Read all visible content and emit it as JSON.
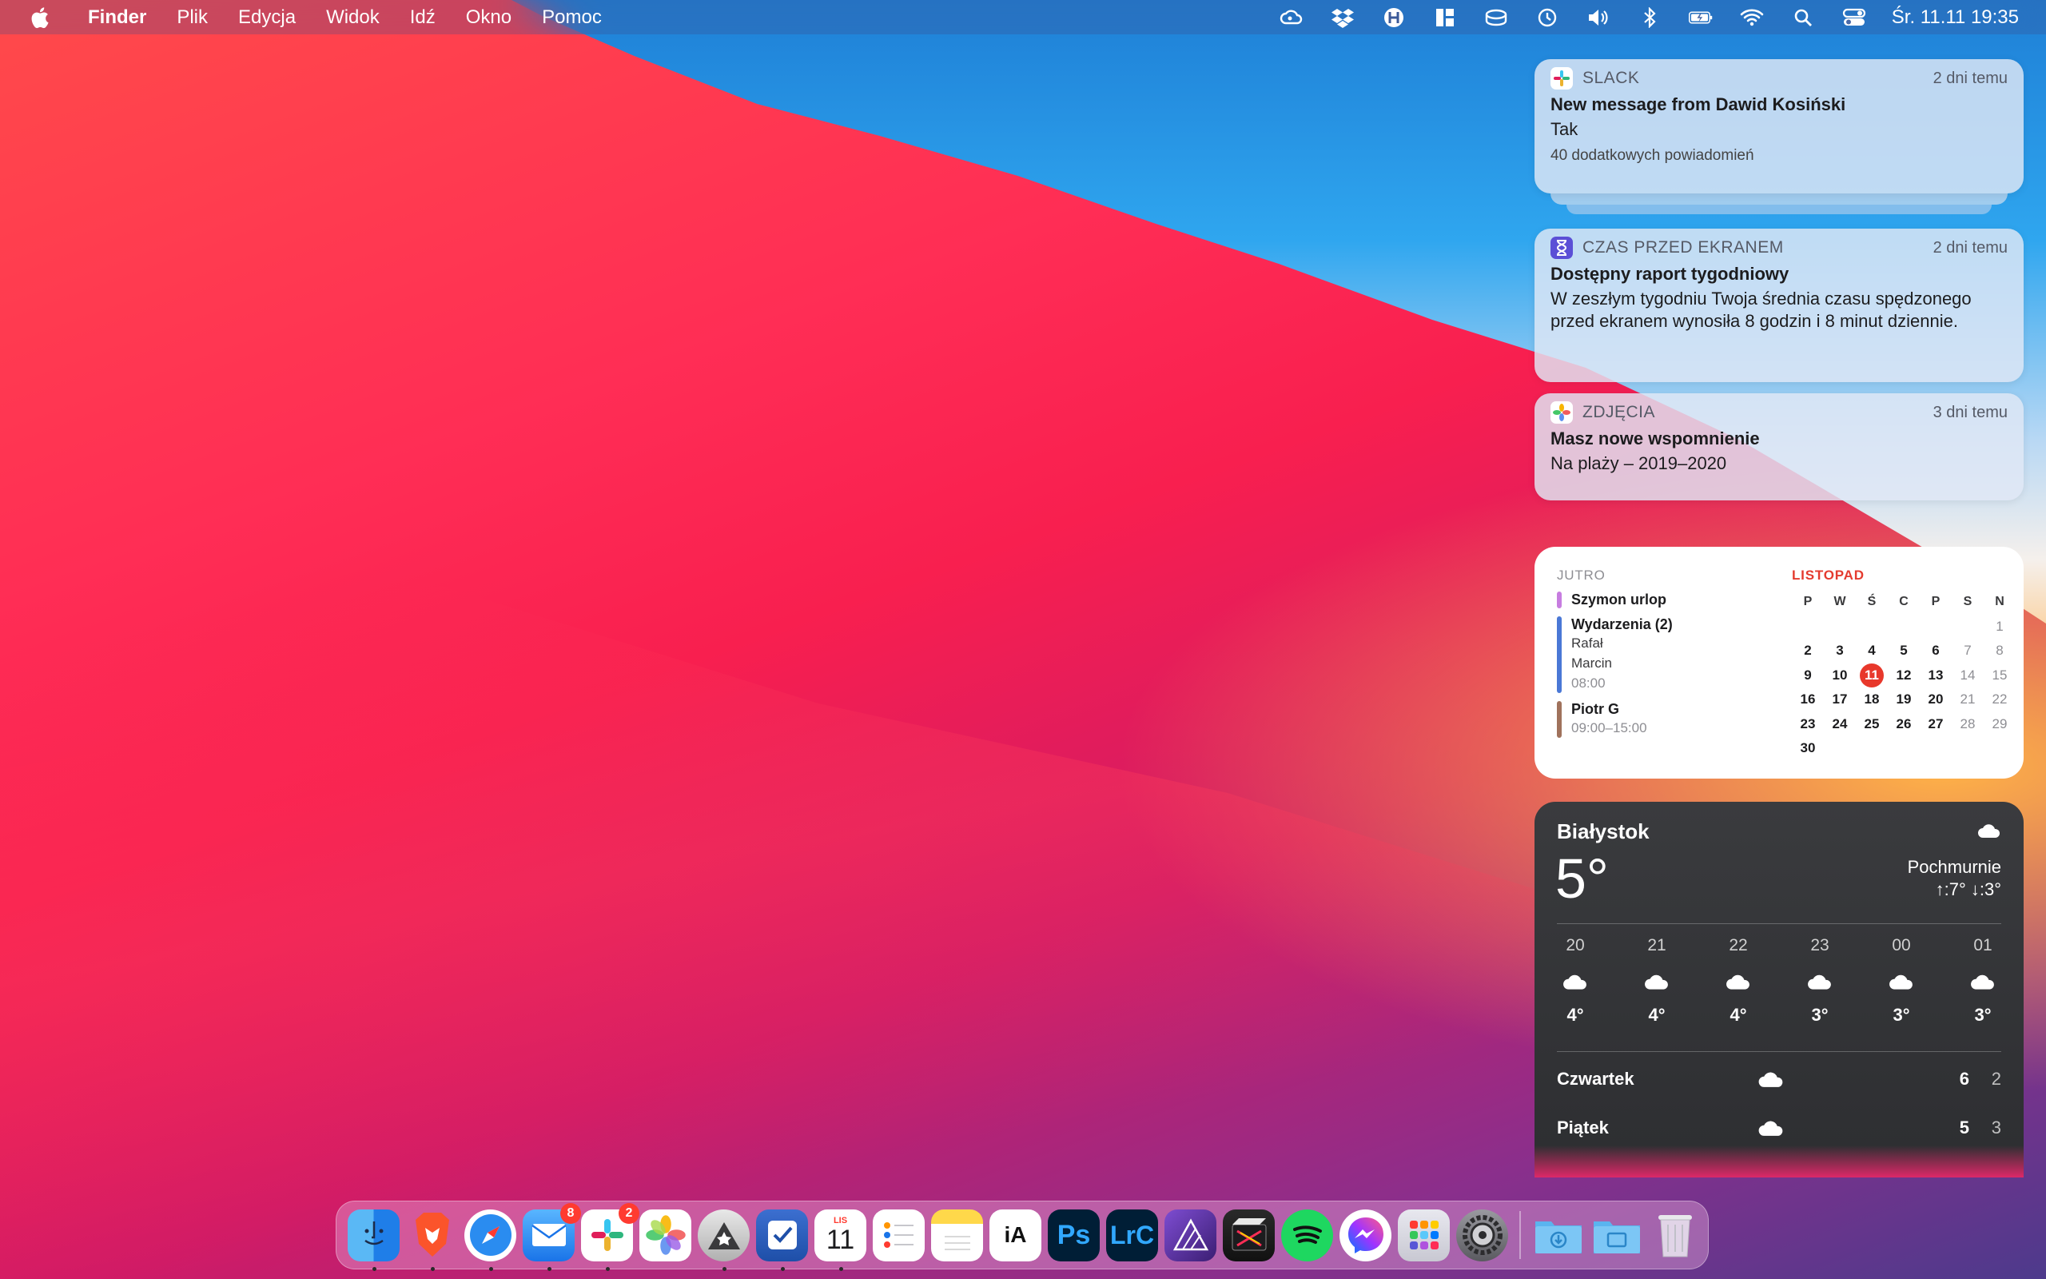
{
  "menubar": {
    "app": "Finder",
    "items": [
      "Plik",
      "Edycja",
      "Widok",
      "Idź",
      "Okno",
      "Pomoc"
    ],
    "clock": "Śr. 11.11  19:35",
    "status_icons": [
      "creative-cloud-icon",
      "dropbox-icon",
      "h-icon",
      "layout-icon",
      "bartender-icon",
      "time-machine-icon",
      "volume-icon",
      "bluetooth-icon",
      "battery-icon",
      "wifi-icon",
      "spotlight-icon",
      "control-center-icon"
    ]
  },
  "notifications": [
    {
      "app": "SLACK",
      "time": "2 dni temu",
      "title": "New message from Dawid Kosiński",
      "body": "Tak",
      "more": "40 dodatkowych powiadomień"
    },
    {
      "app": "CZAS PRZED EKRANEM",
      "time": "2 dni temu",
      "title": "Dostępny raport tygodniowy",
      "body": "W zeszłym tygodniu Twoja średnia czasu spędzonego przed ekranem wynosiła 8 godzin i 8 minut dziennie."
    },
    {
      "app": "ZDJĘCIA",
      "time": "3 dni temu",
      "title": "Masz nowe wspomnienie",
      "body": "Na plaży – 2019–2020"
    }
  ],
  "calendar": {
    "label": "JUTRO",
    "events": [
      {
        "title": "Szymon urlop",
        "color": "#c77de0"
      },
      {
        "title": "Wydarzenia (2)",
        "lines": [
          "Rafał",
          "Marcin"
        ],
        "time": "08:00",
        "color": "#4a78d6"
      },
      {
        "title": "Piotr G",
        "time": "09:00–15:00",
        "color": "#a0725c"
      }
    ],
    "month": "LISTOPAD",
    "weekdays": [
      "P",
      "W",
      "Ś",
      "C",
      "P",
      "S",
      "N"
    ],
    "today": "11",
    "weeks": [
      [
        "",
        "",
        "",
        "",
        "",
        "",
        "1"
      ],
      [
        "2",
        "3",
        "4",
        "5",
        "6",
        "7",
        "8"
      ],
      [
        "9",
        "10",
        "11",
        "12",
        "13",
        "14",
        "15"
      ],
      [
        "16",
        "17",
        "18",
        "19",
        "20",
        "21",
        "22"
      ],
      [
        "23",
        "24",
        "25",
        "26",
        "27",
        "28",
        "29"
      ],
      [
        "30",
        "",
        "",
        "",
        "",
        "",
        ""
      ]
    ]
  },
  "weather": {
    "city": "Białystok",
    "temp": "5°",
    "condition": "Pochmurnie",
    "hilo": "↑:7° ↓:3°",
    "hours": [
      {
        "h": "20",
        "t": "4°"
      },
      {
        "h": "21",
        "t": "4°"
      },
      {
        "h": "22",
        "t": "4°"
      },
      {
        "h": "23",
        "t": "3°"
      },
      {
        "h": "00",
        "t": "3°"
      },
      {
        "h": "01",
        "t": "3°"
      }
    ],
    "days": [
      {
        "name": "Czwartek",
        "hi": "6",
        "lo": "2"
      },
      {
        "name": "Piątek",
        "hi": "5",
        "lo": "3"
      }
    ]
  },
  "dock": {
    "apps": [
      {
        "name": "finder",
        "running": true
      },
      {
        "name": "brave",
        "running": true
      },
      {
        "name": "safari",
        "running": true
      },
      {
        "name": "mail",
        "running": true,
        "badge": "8"
      },
      {
        "name": "slack",
        "running": true,
        "badge": "2"
      },
      {
        "name": "photos",
        "running": false
      },
      {
        "name": "darkroom",
        "running": true
      },
      {
        "name": "things",
        "running": true
      },
      {
        "name": "calendar",
        "running": true,
        "month": "LIS",
        "day": "11"
      },
      {
        "name": "reminders",
        "running": false
      },
      {
        "name": "notes",
        "running": false
      },
      {
        "name": "ia-writer",
        "running": false,
        "label": "iA"
      },
      {
        "name": "photoshop",
        "running": false,
        "label": "Ps"
      },
      {
        "name": "lightroom-classic",
        "running": false,
        "label": "LrC"
      },
      {
        "name": "affinity-photo",
        "running": false
      },
      {
        "name": "final-cut-pro",
        "running": false
      },
      {
        "name": "spotify",
        "running": false
      },
      {
        "name": "messenger",
        "running": false
      },
      {
        "name": "launchpad",
        "running": false
      },
      {
        "name": "system-preferences",
        "running": false
      },
      {
        "name": "downloads",
        "running": false
      },
      {
        "name": "documents",
        "running": false
      },
      {
        "name": "trash",
        "running": false
      }
    ]
  }
}
